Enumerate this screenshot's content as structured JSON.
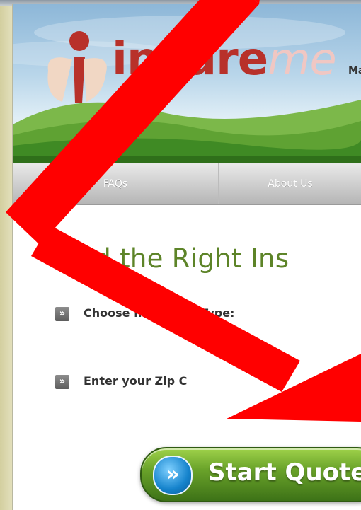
{
  "header": {
    "logo_insure": "insure",
    "logo_me": "me",
    "tagline": "Ma"
  },
  "nav": {
    "items": [
      {
        "label": "FAQs"
      },
      {
        "label": "About Us"
      }
    ]
  },
  "main": {
    "heading": "Find the Right Ins",
    "insurance_type_label": "Choose Insurance Type:",
    "zip_label": "Enter your Zip C",
    "start_quote_label": "Start Quote",
    "bullet_glyph": "»"
  },
  "colors": {
    "heading_green": "#5d8428",
    "logo_red": "#b8312a",
    "annotation_red": "#ff0000",
    "button_green": "#6aa32a",
    "icon_blue": "#1583cc"
  }
}
